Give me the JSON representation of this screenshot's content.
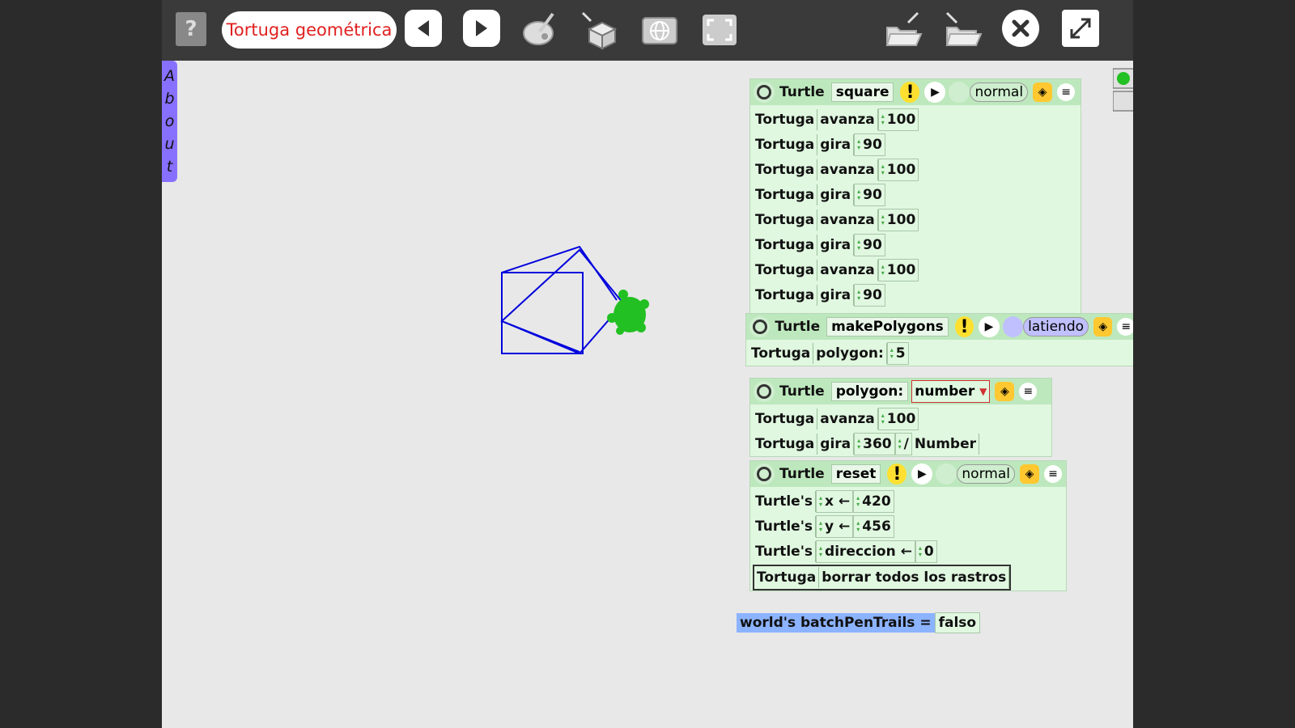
{
  "toolbar": {
    "help_label": "?",
    "project_title": "Tortuga geométrica",
    "icons": [
      "help-icon",
      "prev-arrow-icon",
      "next-arrow-icon",
      "paint-icon",
      "supplies-icon",
      "world-icon",
      "fullscreen-icon",
      "open-project-icon",
      "share-project-icon",
      "close-icon",
      "expand-icon"
    ]
  },
  "about_tab": {
    "letters": [
      "A",
      "b",
      "o",
      "u",
      "t"
    ]
  },
  "scripts": {
    "square": {
      "object": "Turtle",
      "name": "square",
      "status": "normal",
      "rows": [
        {
          "obj": "Tortuga",
          "cmd": "avanza",
          "arg": "100"
        },
        {
          "obj": "Tortuga",
          "cmd": "gira",
          "arg": "90"
        },
        {
          "obj": "Tortuga",
          "cmd": "avanza",
          "arg": "100"
        },
        {
          "obj": "Tortuga",
          "cmd": "gira",
          "arg": "90"
        },
        {
          "obj": "Tortuga",
          "cmd": "avanza",
          "arg": "100"
        },
        {
          "obj": "Tortuga",
          "cmd": "gira",
          "arg": "90"
        },
        {
          "obj": "Tortuga",
          "cmd": "avanza",
          "arg": "100"
        },
        {
          "obj": "Tortuga",
          "cmd": "gira",
          "arg": "90"
        }
      ]
    },
    "makePolygons": {
      "object": "Turtle",
      "name": "makePolygons",
      "status": "latiendo",
      "rows": [
        {
          "obj": "Tortuga",
          "cmd": "polygon:",
          "arg": "5"
        }
      ]
    },
    "polygon": {
      "object": "Turtle",
      "name": "polygon:",
      "param_type": "number",
      "rows": [
        {
          "obj": "Tortuga",
          "cmd": "avanza",
          "arg": "100"
        },
        {
          "obj": "Tortuga",
          "cmd": "gira",
          "arg": "360",
          "op": "/",
          "arg2": "Number"
        }
      ]
    },
    "reset": {
      "object": "Turtle",
      "name": "reset",
      "status": "normal",
      "rows": [
        {
          "obj": "Turtle's",
          "var": "x",
          "assign": "←",
          "val": "420"
        },
        {
          "obj": "Turtle's",
          "var": "y",
          "assign": "←",
          "val": "456"
        },
        {
          "obj": "Turtle's",
          "var": "direccion",
          "assign": "←",
          "val": "0"
        }
      ],
      "clear_row": {
        "obj": "Tortuga",
        "cmd": "borrar todos los rastros"
      }
    }
  },
  "batch": {
    "label": "world's batchPenTrails =",
    "value": "falso"
  },
  "colors": {
    "trail": "#0000dd",
    "turtle": "#22c022",
    "title_text": "#e02020",
    "about_tab": "#8870ff"
  }
}
